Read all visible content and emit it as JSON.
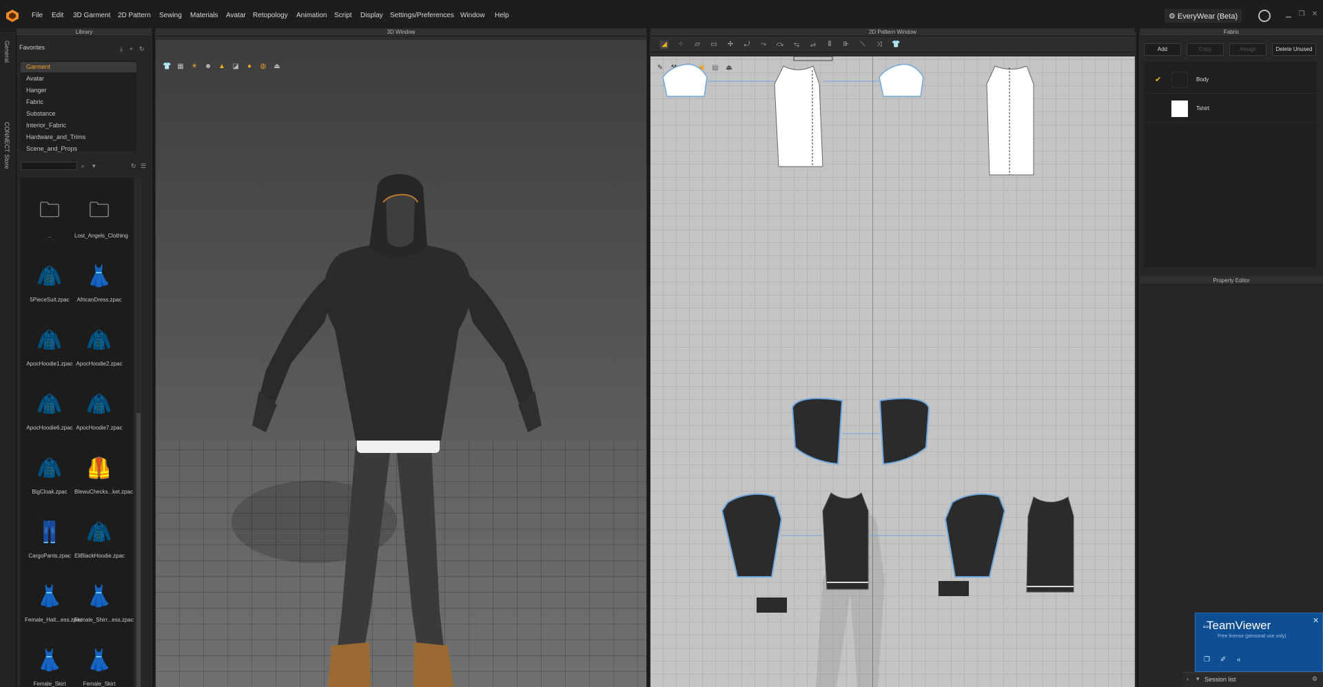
{
  "app": {
    "menu": [
      "File",
      "Edit",
      "3D Garment",
      "2D Pattern",
      "Sewing",
      "Materials",
      "Avatar",
      "Retopology",
      "Animation",
      "Script",
      "Display",
      "Settings/Preferences",
      "Window",
      "Help"
    ],
    "workspace": "EveryWear (Beta)"
  },
  "left_tabs": [
    "General",
    "CONNECT Store"
  ],
  "library": {
    "title": "Library",
    "favorites_label": "Favorites",
    "favorites": [
      "Garment",
      "Avatar",
      "Hanger",
      "Fabric",
      "Substance",
      "Interior_Fabric",
      "Hardware_and_Trims",
      "Scene_and_Props"
    ],
    "selected_favorite": "Garment",
    "items": [
      {
        "label": "..",
        "icon": "folder-icon"
      },
      {
        "label": "Lost_Angels_Clothing",
        "icon": "folder-icon"
      },
      {
        "label": "5PieceSuit.zpac",
        "icon": "suit-icon"
      },
      {
        "label": "AfricanDress.zpac",
        "icon": "dress-icon"
      },
      {
        "label": "ApocHoodie1.zpac",
        "icon": "hoodie-icon"
      },
      {
        "label": "ApocHoodie2.zpac",
        "icon": "hoodie-icon"
      },
      {
        "label": "ApocHoodie6.zpac",
        "icon": "hoodie-icon"
      },
      {
        "label": "ApocHoodie7.zpac",
        "icon": "hoodie-icon"
      },
      {
        "label": "BigCloak.zpac",
        "icon": "cloak-icon"
      },
      {
        "label": "BlewuChecks...ket.zpac",
        "icon": "jacket-icon"
      },
      {
        "label": "CargoPants.zpac",
        "icon": "pants-icon"
      },
      {
        "label": "EliBlackHoodie.zpac",
        "icon": "hoodie-icon"
      },
      {
        "label": "Female_Halt...ess.zpac",
        "icon": "dress-icon"
      },
      {
        "label": "Female_Shirr...ess.zpac",
        "icon": "dress-icon"
      },
      {
        "label": "Female_Skirt",
        "icon": "skirt-icon"
      },
      {
        "label": "Female_Skirt",
        "icon": "skirt-icon"
      }
    ]
  },
  "view3d": {
    "title": "3D Window"
  },
  "view2d": {
    "title": "2D Pattern Window"
  },
  "fabric": {
    "title": "Fabric",
    "buttons": [
      "Add",
      "Copy",
      "Assign",
      "Delete Unused"
    ],
    "items": [
      {
        "name": "Body",
        "swatch": "#1f1f1f",
        "checked": true
      },
      {
        "name": "Tshirt",
        "swatch": "#ffffff",
        "checked": false
      }
    ]
  },
  "property_editor": {
    "title": "Property Editor"
  },
  "teamviewer": {
    "name": "TeamViewer",
    "license": "Free license (personal use only)"
  },
  "session": {
    "label": "Session list"
  },
  "colors": {
    "accent": "#f0a030",
    "teamviewer": "#0e4f94",
    "pattern_outline": "#6fa8dc"
  }
}
